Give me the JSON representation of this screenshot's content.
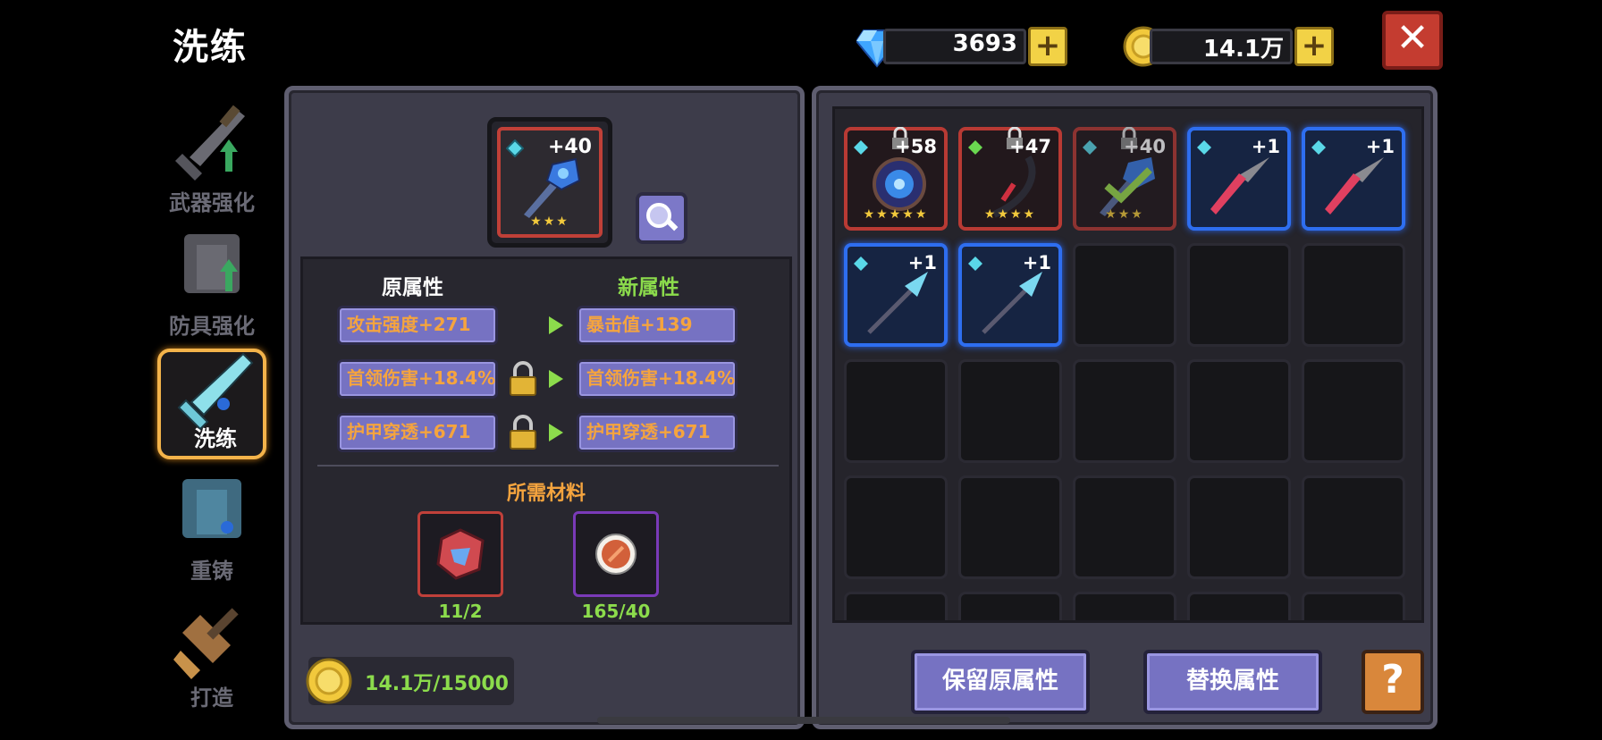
{
  "page": {
    "title": "洗练"
  },
  "currency": {
    "gems": "3693",
    "coins": "14.1万",
    "plus_label": "+"
  },
  "close_label": "✕",
  "sidebar": {
    "items": [
      {
        "label": "武器强化",
        "icon": "sword-upgrade-icon",
        "active": false
      },
      {
        "label": "防具强化",
        "icon": "armor-upgrade-icon",
        "active": false
      },
      {
        "label": "洗练",
        "icon": "refine-sword-icon",
        "active": true
      },
      {
        "label": "重铸",
        "icon": "recast-armor-icon",
        "active": false
      },
      {
        "label": "打造",
        "icon": "forge-hammer-icon",
        "active": false
      }
    ]
  },
  "selected_item": {
    "level": "+40",
    "stars": "★★★"
  },
  "stats": {
    "old_title": "原属性",
    "new_title": "新属性",
    "old": [
      "攻击强度+271",
      "首领伤害+18.4%",
      "护甲穿透+671"
    ],
    "new": [
      "暴击值+139",
      "首领伤害+18.4%",
      "护甲穿透+671"
    ]
  },
  "materials": {
    "title": "所需材料",
    "items": [
      {
        "count": "11/2",
        "icon": "refine-stone-icon"
      },
      {
        "count": "165/40",
        "icon": "copper-orb-icon"
      }
    ]
  },
  "cost": {
    "value": "14.1万/15000"
  },
  "inventory": {
    "items": [
      {
        "level": "+58",
        "stars": "★★★★★",
        "locked": true,
        "frame": "red",
        "icon": "blue-orb-icon"
      },
      {
        "level": "+47",
        "stars": "★★★★",
        "locked": true,
        "frame": "red",
        "icon": "red-bow-icon"
      },
      {
        "level": "+40",
        "stars": "★★★",
        "locked": true,
        "frame": "red",
        "icon": "blue-mace-icon",
        "equipped": true
      },
      {
        "level": "+1",
        "stars": "",
        "locked": false,
        "frame": "blue",
        "icon": "red-spear-icon"
      },
      {
        "level": "+1",
        "stars": "",
        "locked": false,
        "frame": "blue",
        "icon": "red-spear-icon"
      },
      {
        "level": "+1",
        "stars": "",
        "locked": false,
        "frame": "blue",
        "icon": "blue-spear-icon"
      },
      {
        "level": "+1",
        "stars": "",
        "locked": false,
        "frame": "blue",
        "icon": "blue-spear-icon"
      }
    ]
  },
  "buttons": {
    "keep": "保留原属性",
    "replace": "替换属性",
    "help": "?"
  },
  "colors": {
    "accent_orange": "#f5a43e",
    "accent_green": "#8cdc4c",
    "button_purple": "#7672c2",
    "close_red": "#c43c30"
  }
}
